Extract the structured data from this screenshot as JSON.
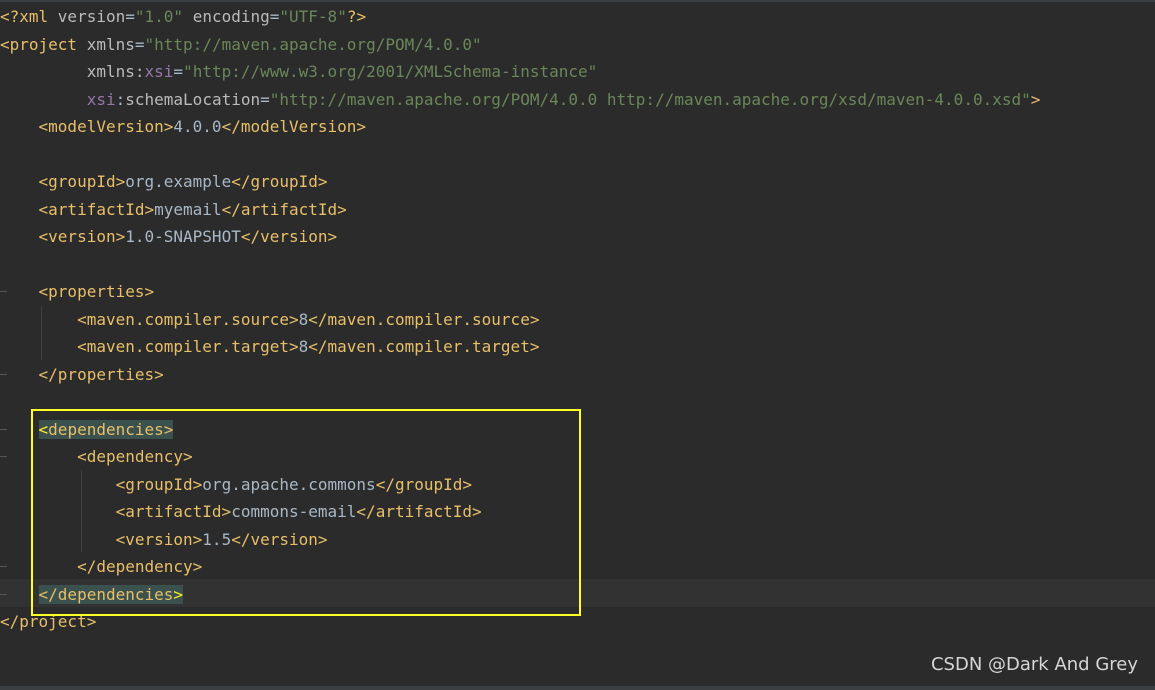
{
  "code_lines": [
    {
      "parts": [
        {
          "c": "t",
          "s": "<?xml "
        },
        {
          "c": "a",
          "s": "version"
        },
        {
          "c": "x",
          "s": "="
        },
        {
          "c": "v",
          "s": "\"1.0\""
        },
        {
          "c": "x",
          "s": " "
        },
        {
          "c": "a",
          "s": "encoding"
        },
        {
          "c": "x",
          "s": "="
        },
        {
          "c": "v",
          "s": "\"UTF-8\""
        },
        {
          "c": "t",
          "s": "?>"
        }
      ]
    },
    {
      "parts": [
        {
          "c": "t",
          "s": "<project "
        },
        {
          "c": "a",
          "s": "xmlns"
        },
        {
          "c": "x",
          "s": "="
        },
        {
          "c": "v",
          "s": "\"http://maven.apache.org/POM/4.0.0\""
        }
      ]
    },
    {
      "parts": [
        {
          "c": "x",
          "s": "         "
        },
        {
          "c": "a",
          "s": "xmlns"
        },
        {
          "c": "x",
          "s": ":"
        },
        {
          "c": "ns",
          "s": "xsi"
        },
        {
          "c": "x",
          "s": "="
        },
        {
          "c": "v",
          "s": "\"http://www.w3.org/2001/XMLSchema-instance\""
        }
      ]
    },
    {
      "parts": [
        {
          "c": "x",
          "s": "         "
        },
        {
          "c": "ns",
          "s": "xsi"
        },
        {
          "c": "x",
          "s": ":"
        },
        {
          "c": "a",
          "s": "schemaLocation"
        },
        {
          "c": "x",
          "s": "="
        },
        {
          "c": "v",
          "s": "\"http://maven.apache.org/POM/4.0.0 http://maven.apache.org/xsd/maven-4.0.0.xsd\""
        },
        {
          "c": "t",
          "s": ">"
        }
      ]
    },
    {
      "parts": [
        {
          "c": "x",
          "s": "    "
        },
        {
          "c": "t",
          "s": "<modelVersion>"
        },
        {
          "c": "x",
          "s": "4.0.0"
        },
        {
          "c": "t",
          "s": "</modelVersion>"
        }
      ]
    },
    {
      "parts": []
    },
    {
      "parts": [
        {
          "c": "x",
          "s": "    "
        },
        {
          "c": "t",
          "s": "<groupId>"
        },
        {
          "c": "x",
          "s": "org.example"
        },
        {
          "c": "t",
          "s": "</groupId>"
        }
      ]
    },
    {
      "parts": [
        {
          "c": "x",
          "s": "    "
        },
        {
          "c": "t",
          "s": "<artifactId>"
        },
        {
          "c": "x",
          "s": "myemail"
        },
        {
          "c": "t",
          "s": "</artifactId>"
        }
      ]
    },
    {
      "parts": [
        {
          "c": "x",
          "s": "    "
        },
        {
          "c": "t",
          "s": "<version>"
        },
        {
          "c": "x",
          "s": "1.0-SNAPSHOT"
        },
        {
          "c": "t",
          "s": "</version>"
        }
      ]
    },
    {
      "parts": []
    },
    {
      "parts": [
        {
          "c": "x",
          "s": "    "
        },
        {
          "c": "t",
          "s": "<properties>"
        }
      ]
    },
    {
      "parts": [
        {
          "c": "x",
          "s": "        "
        },
        {
          "c": "t",
          "s": "<maven.compiler.source>"
        },
        {
          "c": "x",
          "s": "8"
        },
        {
          "c": "t",
          "s": "</maven.compiler.source>"
        }
      ]
    },
    {
      "parts": [
        {
          "c": "x",
          "s": "        "
        },
        {
          "c": "t",
          "s": "<maven.compiler.target>"
        },
        {
          "c": "x",
          "s": "8"
        },
        {
          "c": "t",
          "s": "</maven.compiler.target>"
        }
      ]
    },
    {
      "parts": [
        {
          "c": "x",
          "s": "    "
        },
        {
          "c": "t",
          "s": "</properties>"
        }
      ]
    },
    {
      "parts": []
    },
    {
      "parts": [
        {
          "c": "x",
          "s": "    "
        },
        {
          "c": "br hl",
          "s": "<"
        },
        {
          "c": "t hl",
          "s": "dependencies"
        },
        {
          "c": "t hl",
          "s": ">"
        }
      ]
    },
    {
      "parts": [
        {
          "c": "x",
          "s": "        "
        },
        {
          "c": "t",
          "s": "<dependency>"
        }
      ]
    },
    {
      "parts": [
        {
          "c": "x",
          "s": "            "
        },
        {
          "c": "t",
          "s": "<groupId>"
        },
        {
          "c": "x",
          "s": "org.apache.commons"
        },
        {
          "c": "t",
          "s": "</groupId>"
        }
      ]
    },
    {
      "parts": [
        {
          "c": "x",
          "s": "            "
        },
        {
          "c": "t",
          "s": "<artifactId>"
        },
        {
          "c": "x",
          "s": "commons-email"
        },
        {
          "c": "t",
          "s": "</artifactId>"
        }
      ]
    },
    {
      "parts": [
        {
          "c": "x",
          "s": "            "
        },
        {
          "c": "t",
          "s": "<version>"
        },
        {
          "c": "x",
          "s": "1.5"
        },
        {
          "c": "t",
          "s": "</version>"
        }
      ]
    },
    {
      "parts": [
        {
          "c": "x",
          "s": "        "
        },
        {
          "c": "t",
          "s": "</dependency>"
        }
      ]
    },
    {
      "parts": [
        {
          "c": "x",
          "s": "    "
        },
        {
          "c": "t hl",
          "s": "</dependencies"
        },
        {
          "c": "br hl",
          "s": ">"
        }
      ]
    },
    {
      "parts": [
        {
          "c": "t",
          "s": "</project>"
        }
      ]
    }
  ],
  "watermark": "CSDN @Dark And Grey"
}
